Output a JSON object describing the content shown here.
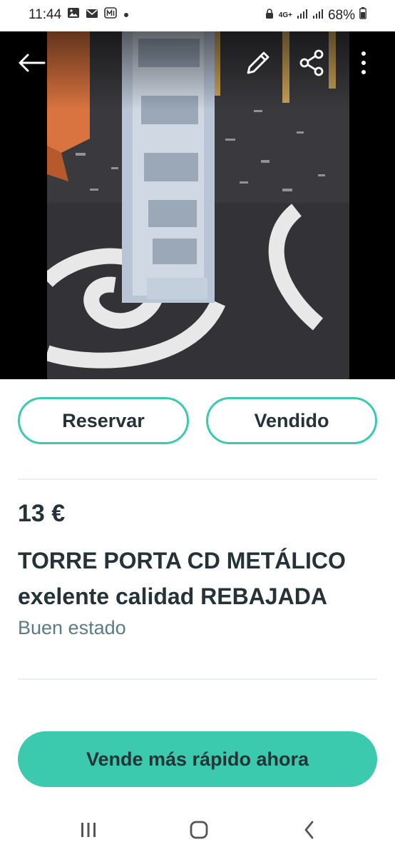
{
  "status_bar": {
    "time": "11:44",
    "network": "4G+",
    "battery": "68%",
    "left_icons": [
      "image-icon",
      "mail-icon",
      "m-app-icon",
      "dot-icon"
    ],
    "right_icons": [
      "lock-icon",
      "signal-icon",
      "signal-icon",
      "battery-icon"
    ]
  },
  "photo": {
    "description_icon_names": [
      "back-arrow-icon",
      "pencil-icon",
      "share-icon",
      "more-vert-icon"
    ]
  },
  "actions": {
    "reserve_label": "Reservar",
    "sold_label": "Vendido"
  },
  "item": {
    "price": "13 €",
    "title": "TORRE PORTA CD METÁLICO exelente calidad REBAJADA",
    "condition": "Buen estado"
  },
  "cta": {
    "label": "Vende más rápido ahora"
  },
  "colors": {
    "accent": "#3bcaae",
    "text": "#253238",
    "muted": "#5c7a8a"
  }
}
